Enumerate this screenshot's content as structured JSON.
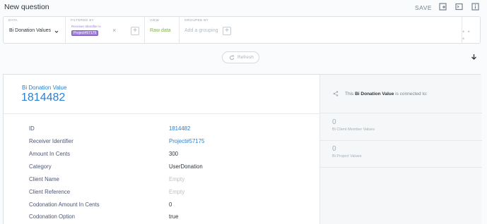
{
  "header": {
    "title": "New question",
    "save_label": "SAVE",
    "icons": [
      "add-to-dashboard-icon",
      "console-icon",
      "info-icon"
    ]
  },
  "query_bar": {
    "data": {
      "label": "DATA",
      "value": "Bi Donation Values"
    },
    "filtered_by": {
      "label": "FILTERED BY",
      "filter_field": "Receiver Identifier is",
      "filter_value": "Project#57175"
    },
    "view": {
      "label": "VIEW",
      "value": "Raw data"
    },
    "grouped_by": {
      "label": "GROUPED BY",
      "placeholder": "Add a grouping"
    },
    "more": "• • •"
  },
  "refresh_label": "Refresh",
  "record": {
    "entity_name": "Bi Donation Value",
    "id_value": "1814482",
    "fields": [
      {
        "label": "ID",
        "value": "1814482",
        "style": "link"
      },
      {
        "label": "Receiver Identifier",
        "value": "Project#57175",
        "style": "link"
      },
      {
        "label": "Amount In Cents",
        "value": "300",
        "style": "plain"
      },
      {
        "label": "Category",
        "value": "UserDonation",
        "style": "plain"
      },
      {
        "label": "Client Name",
        "value": "Empty",
        "style": "empty"
      },
      {
        "label": "Client Reference",
        "value": "Empty",
        "style": "empty"
      },
      {
        "label": "Codonation Amount In Cents",
        "value": "0",
        "style": "plain"
      },
      {
        "label": "Codonation Option",
        "value": "true",
        "style": "plain"
      }
    ]
  },
  "connections": {
    "prefix": "This ",
    "entity": "Bi Donation Value",
    "suffix": " is connected to:",
    "relations": [
      {
        "count": "0",
        "name": "Bi Client Member Values"
      },
      {
        "count": "0",
        "name": "Bi Project Values"
      }
    ]
  },
  "colors": {
    "accent": "#2b7fd1",
    "filter": "#9f80d6",
    "view": "#7fb24b"
  }
}
